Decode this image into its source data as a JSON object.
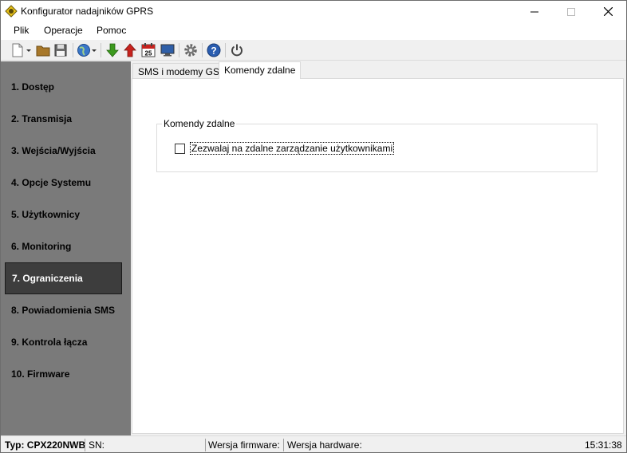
{
  "window": {
    "title": "Konfigurator nadajników GPRS"
  },
  "menu": {
    "items": [
      "Plik",
      "Operacje",
      "Pomoc"
    ]
  },
  "toolbar": {
    "icons": [
      "new-document-icon",
      "open-folder-icon",
      "save-icon",
      "globe-icon",
      "download-arrow-icon",
      "upload-arrow-icon",
      "calendar-icon",
      "monitor-icon",
      "gear-icon",
      "help-icon",
      "power-icon"
    ],
    "calendar_day": "25"
  },
  "sidebar": {
    "items": [
      {
        "label": "1. Dostęp"
      },
      {
        "label": "2. Transmisja"
      },
      {
        "label": "3. Wejścia/Wyjścia"
      },
      {
        "label": "4. Opcje Systemu"
      },
      {
        "label": "5. Użytkownicy"
      },
      {
        "label": "6. Monitoring"
      },
      {
        "label": "7. Ograniczenia"
      },
      {
        "label": "8. Powiadomienia SMS"
      },
      {
        "label": "9. Kontrola łącza"
      },
      {
        "label": "10. Firmware"
      }
    ],
    "active_index": 6
  },
  "tabs": [
    {
      "label": "SMS i modemy GSM"
    },
    {
      "label": "Komendy zdalne"
    }
  ],
  "active_tab": 1,
  "panel": {
    "group_title": "Komendy zdalne",
    "checkbox_label": "Zezwalaj na zdalne zarządzanie użytkownikami",
    "checkbox_checked": false
  },
  "status": {
    "type": "Typ: CPX220NWB",
    "sn": "SN:",
    "firmware": "Wersja firmware:",
    "hardware": "Wersja hardware:",
    "time": "15:31:38"
  },
  "colors": {
    "sidebar_bg": "#7a7a7a",
    "sidebar_active_bg": "#3d3d3d",
    "arrow_down": "#3c9a1e",
    "arrow_up": "#c8231e",
    "help_blue": "#2a5db0"
  }
}
